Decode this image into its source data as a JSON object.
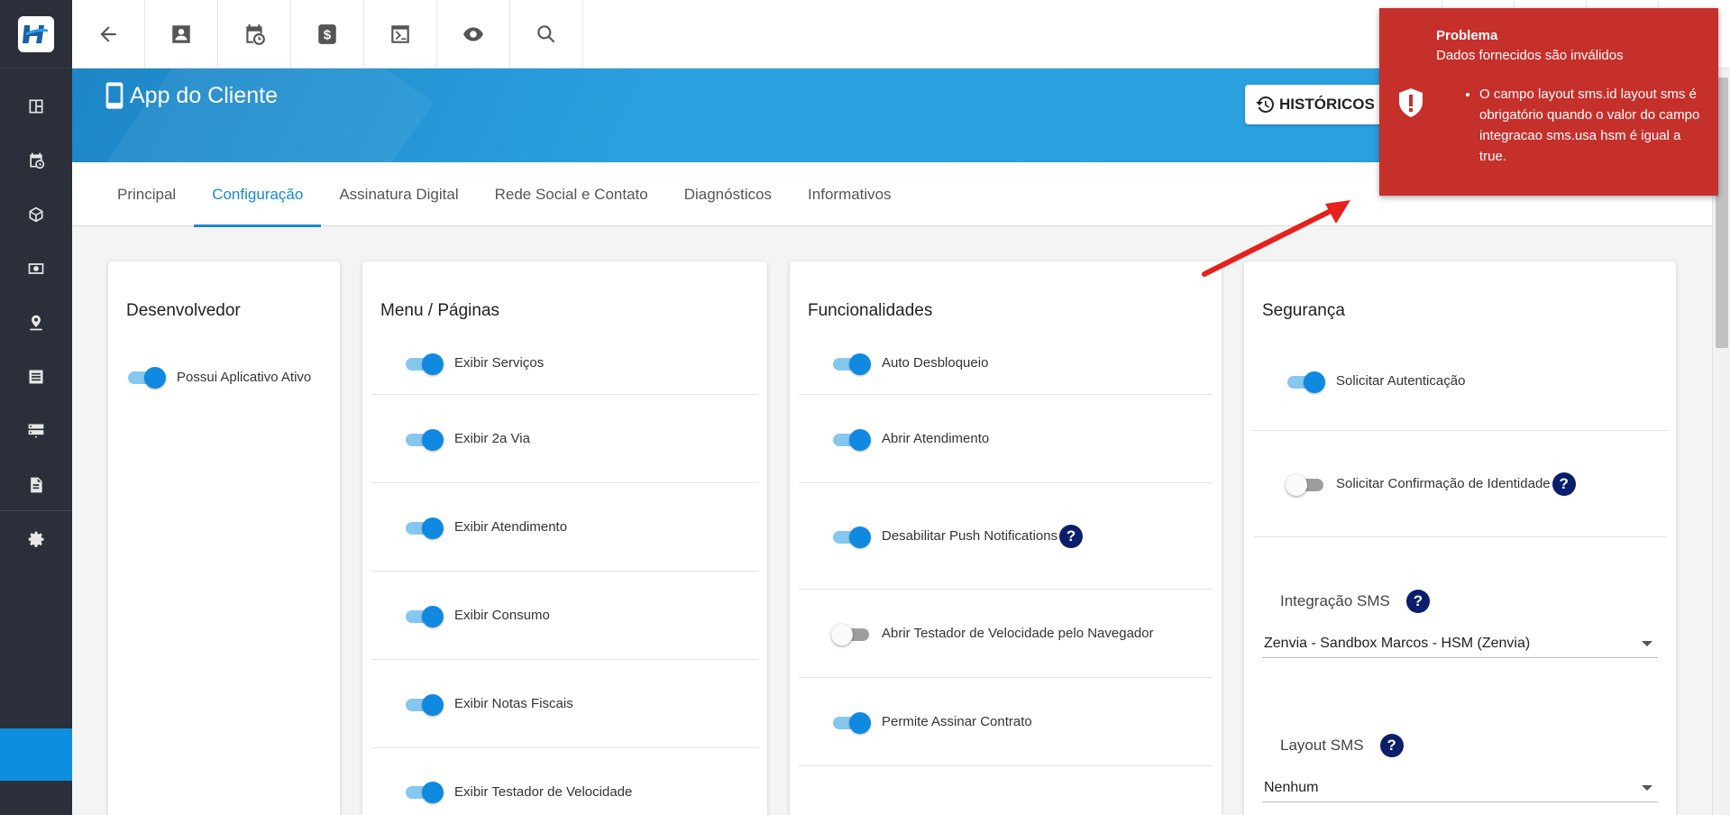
{
  "header": {
    "title": "App do Cliente",
    "historicos_label": "HISTÓRICOS"
  },
  "tabs": [
    {
      "label": "Principal"
    },
    {
      "label": "Configuração"
    },
    {
      "label": "Assinatura Digital"
    },
    {
      "label": "Rede Social e Contato"
    },
    {
      "label": "Diagnósticos"
    },
    {
      "label": "Informativos"
    }
  ],
  "active_tab": "Configuração",
  "desenvolvedor": {
    "title": "Desenvolvedor",
    "items": [
      {
        "label": "Possui Aplicativo Ativo",
        "on": true
      }
    ]
  },
  "menu": {
    "title": "Menu / Páginas",
    "items": [
      {
        "label": "Exibir Serviços",
        "on": true
      },
      {
        "label": "Exibir 2a Via",
        "on": true
      },
      {
        "label": "Exibir Atendimento",
        "on": true
      },
      {
        "label": "Exibir Consumo",
        "on": true
      },
      {
        "label": "Exibir Notas Fiscais",
        "on": true
      },
      {
        "label": "Exibir Testador de Velocidade",
        "on": true
      }
    ]
  },
  "funcionalidades": {
    "title": "Funcionalidades",
    "items": [
      {
        "label": "Auto Desbloqueio",
        "on": true
      },
      {
        "label": "Abrir Atendimento",
        "on": true
      },
      {
        "label": "Desabilitar Push Notifications",
        "on": true
      },
      {
        "label": "Abrir Testador de Velocidade pelo Navegador",
        "on": false
      },
      {
        "label": "Permite Assinar Contrato",
        "on": true
      }
    ]
  },
  "seguranca": {
    "title": "Segurança",
    "items": [
      {
        "label": "Solicitar Autenticação",
        "on": true
      },
      {
        "label": "Solicitar Confirmação de Identidade",
        "on": false
      }
    ],
    "integracao_sms": {
      "label": "Integração SMS",
      "value": "Zenvia - Sandbox Marcos - HSM (Zenvia)"
    },
    "layout_sms": {
      "label": "Layout SMS",
      "value": "Nenhum"
    }
  },
  "help_glyph": "?",
  "toast": {
    "title": "Problema",
    "subtitle": "Dados fornecidos são inválidos",
    "message": "O campo layout sms.id layout sms é obrigatório quando o valor do campo integracao sms.usa hsm é igual a true.",
    "color": "#c6302b"
  },
  "colors": {
    "accent": "#1a88d0",
    "sidebar": "#2b2f3a",
    "toggle_on": "#1089e0"
  },
  "icons": {
    "sidebar": [
      "dashboard-icon",
      "calendar-clock-icon",
      "box-icon",
      "money-icon",
      "location-icon",
      "list-icon",
      "server-icon",
      "document-icon",
      "gear-icon"
    ],
    "toolbar": [
      "arrow-back-icon",
      "contact-icon",
      "calendar-clock-icon",
      "dollar-icon",
      "terminal-icon",
      "eye-icon",
      "search-icon"
    ]
  }
}
